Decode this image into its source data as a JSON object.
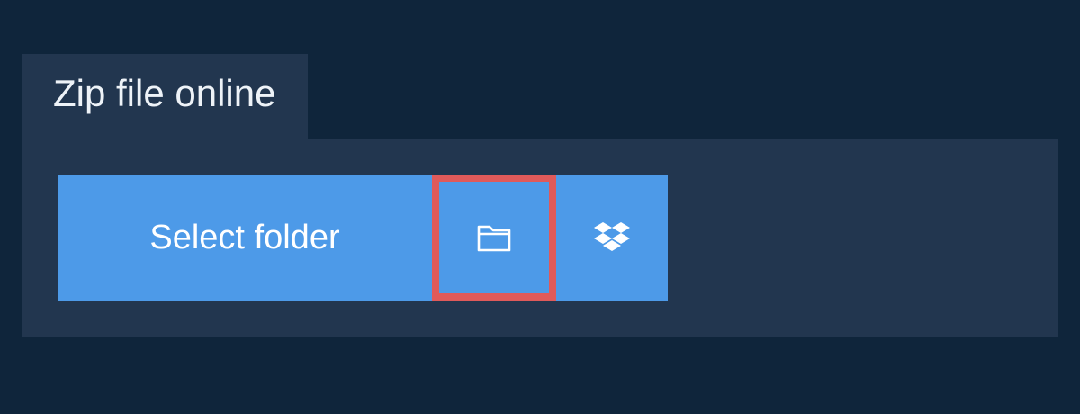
{
  "tab": {
    "title": "Zip file online"
  },
  "actions": {
    "select_folder_label": "Select folder",
    "local_folder_icon": "folder-icon",
    "dropbox_icon": "dropbox-icon"
  },
  "colors": {
    "page_background": "#0f253b",
    "panel_background": "#22364f",
    "button_background": "#4d9ae8",
    "highlight_border": "#e05a5a",
    "text": "#ffffff"
  }
}
